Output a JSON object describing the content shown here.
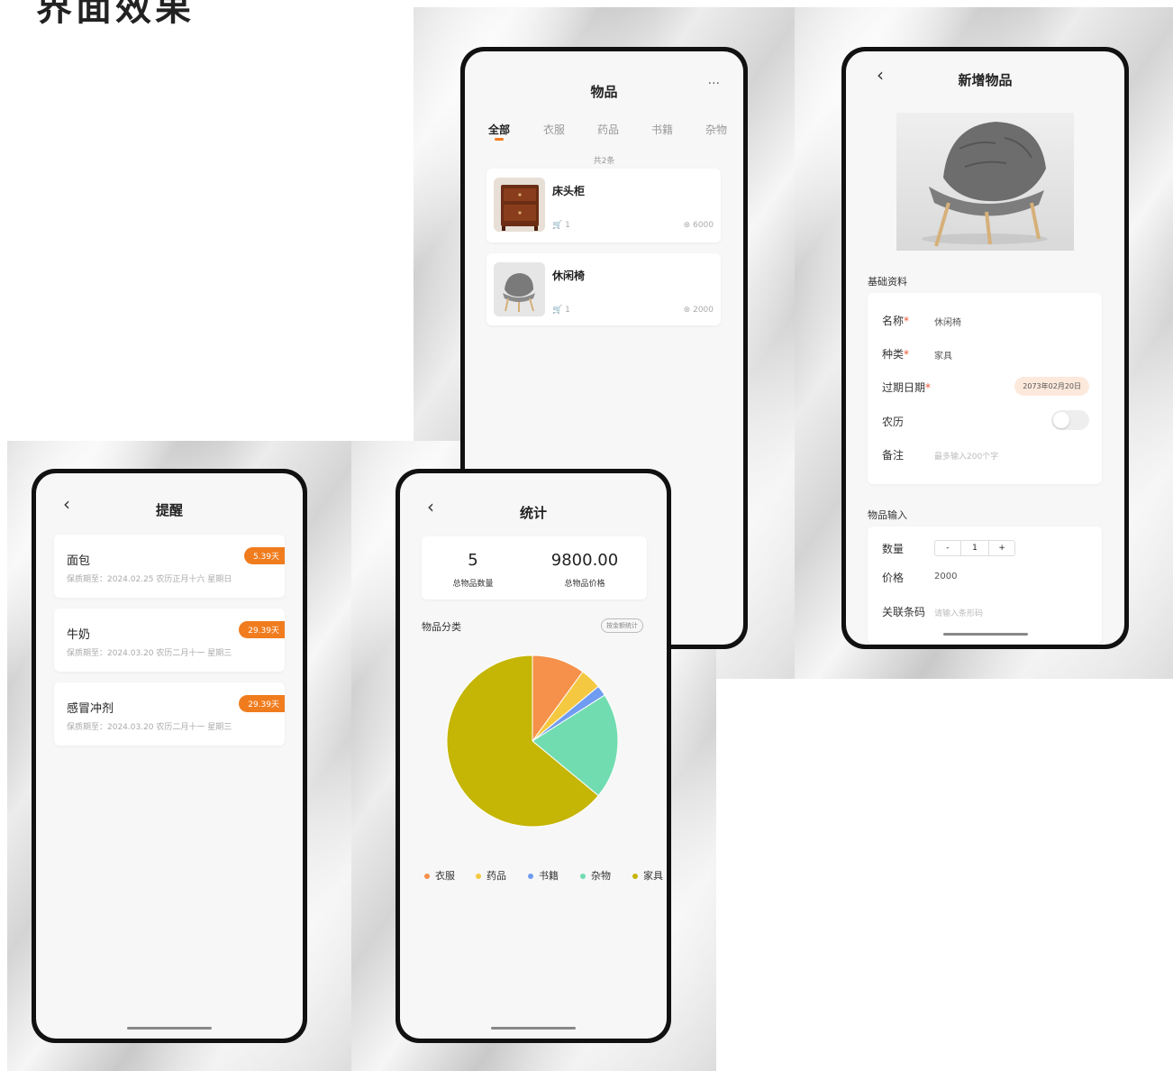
{
  "page_heading": "界面效果",
  "items_screen": {
    "title": "物品",
    "more_icon": "···",
    "tabs": [
      "全部",
      "衣服",
      "药品",
      "书籍",
      "杂物"
    ],
    "count_text": "共2条",
    "items": [
      {
        "name": "床头柜",
        "qty": "1",
        "price": "6000"
      },
      {
        "name": "休闲椅",
        "qty": "1",
        "price": "2000"
      }
    ],
    "cart_icon": "cart-icon",
    "coin_icon": "coin-icon"
  },
  "add_screen": {
    "title": "新增物品",
    "back": "‹",
    "section_basic": "基础资料",
    "fields": {
      "name_label": "名称",
      "name_value": "休闲椅",
      "type_label": "种类",
      "type_value": "家具",
      "expire_label": "过期日期",
      "expire_value": "2073年02月20日",
      "lunar_label": "农历",
      "note_label": "备注",
      "note_placeholder": "最多输入200个字"
    },
    "section_input": "物品输入",
    "input": {
      "qty_label": "数量",
      "minus": "-",
      "qty_value": "1",
      "plus": "+",
      "price_label": "价格",
      "price_value": "2000",
      "barcode_label": "关联条码",
      "barcode_placeholder": "请输入条形码"
    },
    "required_mark": "*"
  },
  "reminder_screen": {
    "title": "提醒",
    "back": "‹",
    "items": [
      {
        "name": "面包",
        "badge": "5.39天",
        "sub": "保质期至：2024.02.25 农历正月十六 星期日"
      },
      {
        "name": "牛奶",
        "badge": "29.39天",
        "sub": "保质期至：2024.03.20 农历二月十一 星期三"
      },
      {
        "name": "感冒冲剂",
        "badge": "29.39天",
        "sub": "保质期至：2024.03.20 农历二月十一 星期三"
      }
    ]
  },
  "stats_screen": {
    "title": "统计",
    "back": "‹",
    "total_count": "5",
    "total_count_label": "总物品数量",
    "total_price": "9800.00",
    "total_price_label": "总物品价格",
    "category_title": "物品分类",
    "toggle_label": "按金额统计",
    "legend": [
      {
        "label": "衣服",
        "color": "#f5914a"
      },
      {
        "label": "药品",
        "color": "#f5c842"
      },
      {
        "label": "书籍",
        "color": "#6f9cf0"
      },
      {
        "label": "杂物",
        "color": "#72dcb1"
      },
      {
        "label": "家具",
        "color": "#c5b504"
      }
    ]
  },
  "chart_data": {
    "type": "pie",
    "categories": [
      "衣服",
      "药品",
      "书籍",
      "杂物",
      "家具"
    ],
    "values": [
      10,
      4,
      2,
      20,
      64
    ],
    "colors": [
      "#f5914a",
      "#f5c842",
      "#6f9cf0",
      "#72dcb1",
      "#c5b504"
    ],
    "legend_position": "bottom"
  }
}
